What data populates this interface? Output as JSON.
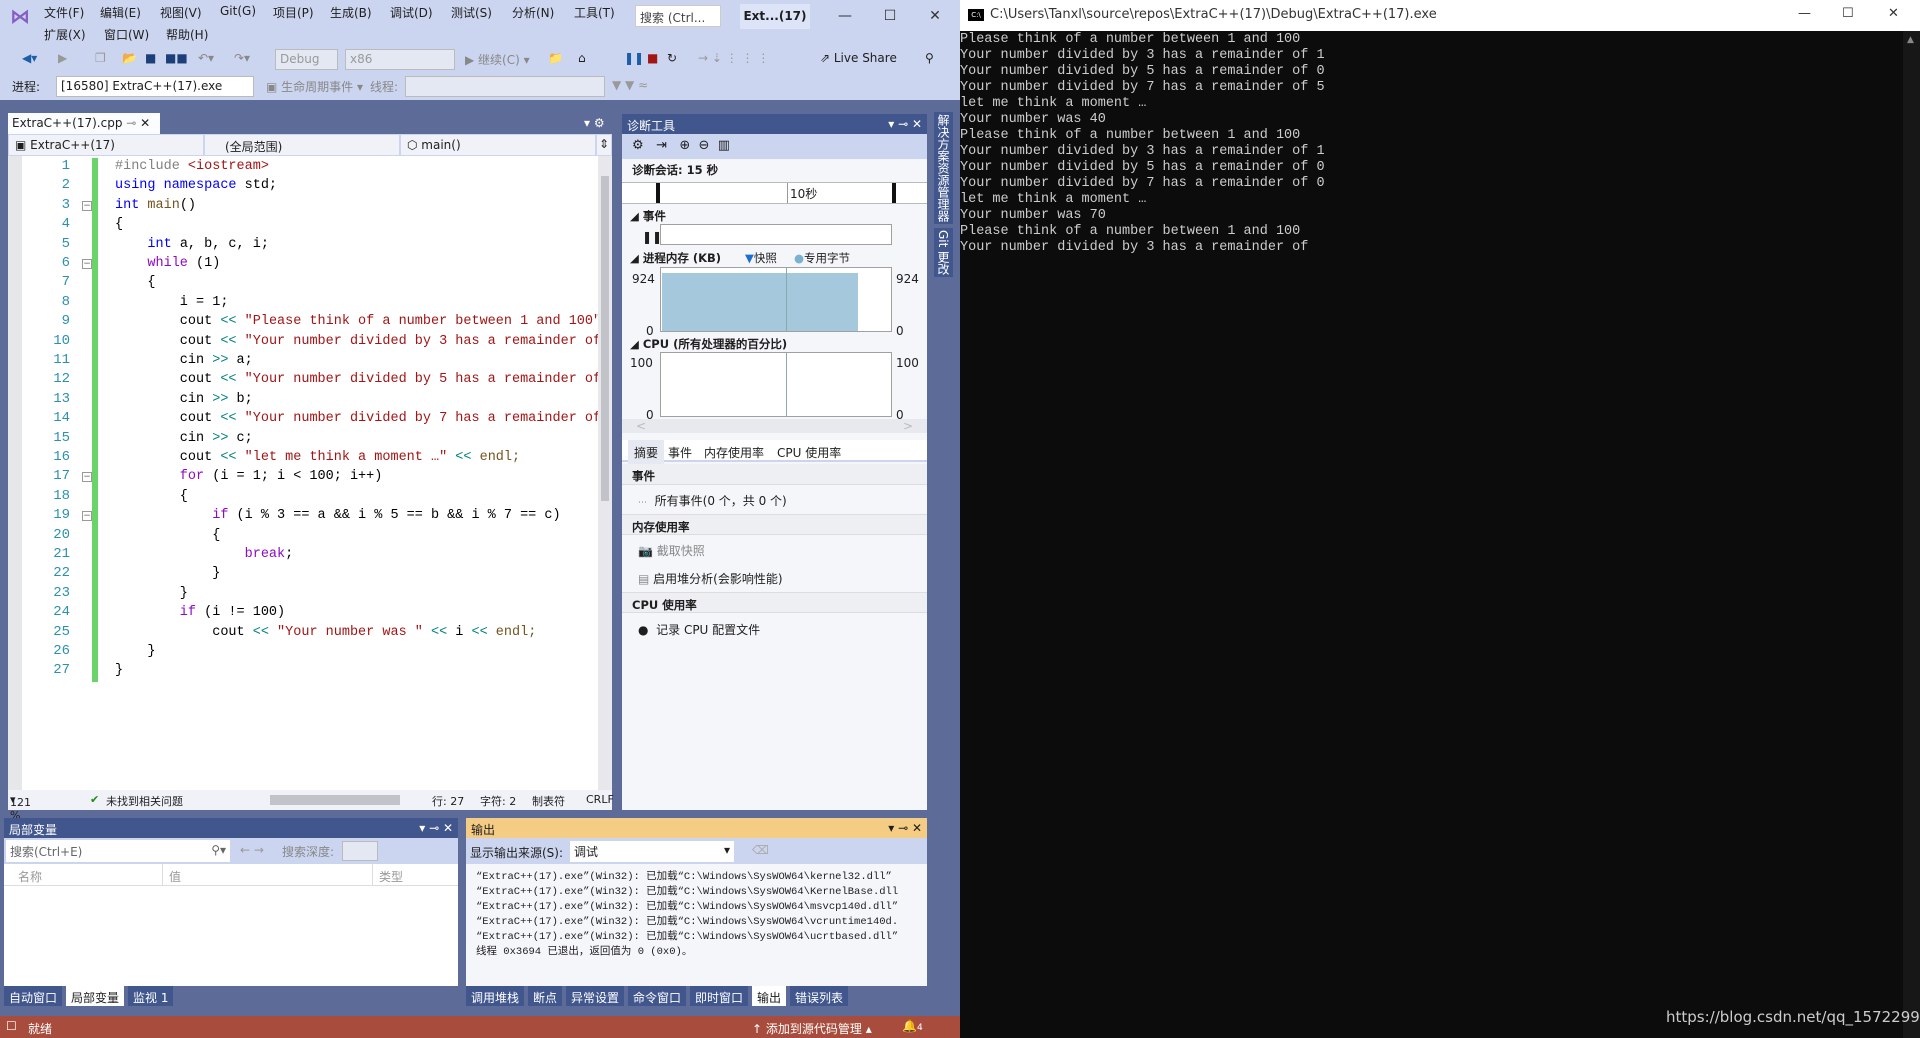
{
  "vs": {
    "menu": [
      "文件(F)",
      "编辑(E)",
      "视图(V)",
      "Git(G)",
      "项目(P)",
      "生成(B)",
      "调试(D)",
      "测试(S)",
      "分析(N)",
      "工具(T)"
    ],
    "menu2": [
      "扩展(X)",
      "窗口(W)",
      "帮助(H)"
    ],
    "search_placeholder": "搜索 (Ctrl...",
    "window_title": "Ext...(17)",
    "toolbar": {
      "config": "Debug",
      "platform": "x86",
      "continue": "继续(C)",
      "live_share": "Live Share",
      "process_label": "进程:",
      "process": "[16580] ExtraC++(17).exe",
      "lifecycle": "生命周期事件",
      "thread_label": "线程:"
    },
    "doc_tab": "ExtraC++(17).cpp",
    "nav": {
      "project": "ExtraC++(17)",
      "scope": "(全局范围)",
      "member": "main()"
    },
    "code": [
      [
        [
          "#include ",
          "p"
        ],
        [
          "<iostream>",
          "s"
        ]
      ],
      [
        [
          "using ",
          "k"
        ],
        [
          "namespace ",
          "k"
        ],
        [
          "std;",
          "n"
        ]
      ],
      [
        [
          "int ",
          "k"
        ],
        [
          "main",
          "f"
        ],
        [
          "()",
          "n"
        ]
      ],
      [
        [
          "{",
          "n"
        ]
      ],
      [
        [
          "    int ",
          "k"
        ],
        [
          "a, b, c, i;",
          "n"
        ]
      ],
      [
        [
          "    while ",
          "c"
        ],
        [
          "(1)",
          "n"
        ]
      ],
      [
        [
          "    {",
          "n"
        ]
      ],
      [
        [
          "        i = 1;",
          "n"
        ]
      ],
      [
        [
          "        cout ",
          "n"
        ],
        [
          "<< ",
          "o"
        ],
        [
          "\"Please think of a number between 1 and 100\"",
          "s"
        ]
      ],
      [
        [
          "        cout ",
          "n"
        ],
        [
          "<< ",
          "o"
        ],
        [
          "\"Your number divided by 3 has a remainder of",
          "s"
        ]
      ],
      [
        [
          "        cin ",
          "n"
        ],
        [
          ">> ",
          "o"
        ],
        [
          "a;",
          "n"
        ]
      ],
      [
        [
          "        cout ",
          "n"
        ],
        [
          "<< ",
          "o"
        ],
        [
          "\"Your number divided by 5 has a remainder of",
          "s"
        ]
      ],
      [
        [
          "        cin ",
          "n"
        ],
        [
          ">> ",
          "o"
        ],
        [
          "b;",
          "n"
        ]
      ],
      [
        [
          "        cout ",
          "n"
        ],
        [
          "<< ",
          "o"
        ],
        [
          "\"Your number divided by 7 has a remainder of",
          "s"
        ]
      ],
      [
        [
          "        cin ",
          "n"
        ],
        [
          ">> ",
          "o"
        ],
        [
          "c;",
          "n"
        ]
      ],
      [
        [
          "        cout ",
          "n"
        ],
        [
          "<< ",
          "o"
        ],
        [
          "\"let me think a moment …\"",
          "s"
        ],
        [
          " << ",
          "o"
        ],
        [
          "endl;",
          "f"
        ]
      ],
      [
        [
          "        for ",
          "c"
        ],
        [
          "(i = 1; i < 100; i++)",
          "n"
        ]
      ],
      [
        [
          "        {",
          "n"
        ]
      ],
      [
        [
          "            if ",
          "c"
        ],
        [
          "(i % 3 == a && i % 5 == b && i % 7 == c)",
          "n"
        ]
      ],
      [
        [
          "            {",
          "n"
        ]
      ],
      [
        [
          "                break",
          "c"
        ],
        [
          ";",
          "n"
        ]
      ],
      [
        [
          "            }",
          "n"
        ]
      ],
      [
        [
          "        }",
          "n"
        ]
      ],
      [
        [
          "        if ",
          "c"
        ],
        [
          "(i != 100)",
          "n"
        ]
      ],
      [
        [
          "            cout ",
          "n"
        ],
        [
          "<< ",
          "o"
        ],
        [
          "\"Your number was \"",
          "s"
        ],
        [
          " << ",
          "o"
        ],
        [
          "i ",
          "n"
        ],
        [
          "<< ",
          "o"
        ],
        [
          "endl;",
          "f"
        ]
      ],
      [
        [
          "    }",
          "n"
        ]
      ],
      [
        [
          "}",
          "n"
        ]
      ]
    ],
    "editor_status": {
      "zoom": "121 %",
      "issues": "未找到相关问题",
      "line": "行: 27",
      "char": "字符: 2",
      "tabs": "制表符",
      "eol": "CRLF"
    },
    "diag": {
      "title": "诊断工具",
      "session": "诊断会话: 15 秒",
      "tick": "10秒",
      "events": "事件",
      "memory": "进程内存 (KB)",
      "snapshot": "快照",
      "private_bytes": "专用字节",
      "mem_max": "924",
      "mem_min": "0",
      "cpu": "CPU (所有处理器的百分比)",
      "cpu_max": "100",
      "cpu_min": "0",
      "tabs": [
        "摘要",
        "事件",
        "内存使用率",
        "CPU 使用率"
      ],
      "s_events": "事件",
      "all_events": "所有事件(0 个，共 0 个)",
      "s_memory": "内存使用率",
      "take_snapshot": "截取快照",
      "heap": "启用堆分析(会影响性能)",
      "s_cpu": "CPU 使用率",
      "record_cpu": "记录 CPU 配置文件",
      "memory_fill_percent": 92
    },
    "side_tabs": [
      "解决方案资源管理器",
      "Git 更改"
    ],
    "locals": {
      "title": "局部变量",
      "search_placeholder": "搜索(Ctrl+E)",
      "depth": "搜索深度:",
      "cols": [
        "名称",
        "值",
        "类型"
      ],
      "tabs": [
        "自动窗口",
        "局部变量",
        "监视 1"
      ]
    },
    "output": {
      "title": "输出",
      "source_label": "显示输出来源(S):",
      "source": "调试",
      "lines": [
        "“ExtraC++(17).exe”(Win32): 已加载“C:\\Windows\\SysWOW64\\kernel32.dll”",
        "“ExtraC++(17).exe”(Win32): 已加载“C:\\Windows\\SysWOW64\\KernelBase.dll",
        "“ExtraC++(17).exe”(Win32): 已加载“C:\\Windows\\SysWOW64\\msvcp140d.dll”",
        "“ExtraC++(17).exe”(Win32): 已加载“C:\\Windows\\SysWOW64\\vcruntime140d.",
        "“ExtraC++(17).exe”(Win32): 已加载“C:\\Windows\\SysWOW64\\ucrtbased.dll”",
        "线程 0x3694 已退出，返回值为 0 (0x0)。"
      ],
      "tabs": [
        "调用堆栈",
        "断点",
        "异常设置",
        "命令窗口",
        "即时窗口",
        "输出",
        "错误列表"
      ]
    },
    "status": {
      "ready": "就绪",
      "source_control": "添加到源代码管理",
      "notifications": "4"
    }
  },
  "console": {
    "title": "C:\\Users\\Tanxl\\source\\repos\\ExtraC++(17)\\Debug\\ExtraC++(17).exe",
    "lines": [
      "Please think of a number between 1 and 100",
      "Your number divided by 3 has a remainder of 1",
      "Your number divided by 5 has a remainder of 0",
      "Your number divided by 7 has a remainder of 5",
      "let me think a moment …",
      "Your number was 40",
      "Please think of a number between 1 and 100",
      "Your number divided by 3 has a remainder of 1",
      "Your number divided by 5 has a remainder of 0",
      "Your number divided by 7 has a remainder of 0",
      "let me think a moment …",
      "Your number was 70",
      "Please think of a number between 1 and 100",
      "Your number divided by 3 has a remainder of"
    ],
    "watermark": "https://blog.csdn.net/qq_1572299"
  },
  "colors": {
    "accent": "#40568d",
    "status_bar": "#a84d3d",
    "output_header": "#f5cc84",
    "git_bar": "#6ad46a"
  }
}
